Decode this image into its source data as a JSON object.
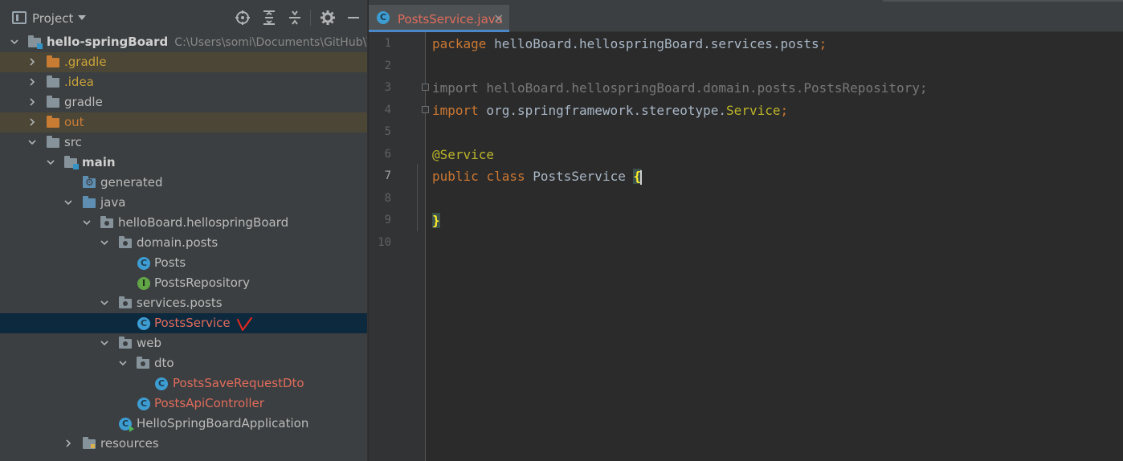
{
  "project_panel": {
    "title": "Project",
    "tree": [
      {
        "label": "hello-springBoard",
        "path": "C:\\Users\\somi\\Documents\\GitHub\\T",
        "icon": "module-folder-icon",
        "expanded": true
      },
      {
        "label": ".gradle",
        "icon": "excluded-folder-icon",
        "expanded": false
      },
      {
        "label": ".idea",
        "icon": "excluded-folder-icon",
        "expanded": false
      },
      {
        "label": "gradle",
        "icon": "folder-icon",
        "expanded": false
      },
      {
        "label": "out",
        "icon": "excluded-folder-icon",
        "expanded": false
      },
      {
        "label": "src",
        "icon": "folder-icon",
        "expanded": true
      },
      {
        "label": "main",
        "icon": "module-folder-icon",
        "expanded": true
      },
      {
        "label": "generated",
        "icon": "generated-folder-icon"
      },
      {
        "label": "java",
        "icon": "source-folder-icon",
        "expanded": true
      },
      {
        "label": "helloBoard.hellospringBoard",
        "icon": "package-icon",
        "expanded": true
      },
      {
        "label": "domain.posts",
        "icon": "package-icon",
        "expanded": true
      },
      {
        "label": "Posts",
        "icon": "class-icon",
        "glyph": "C"
      },
      {
        "label": "PostsRepository",
        "icon": "interface-icon",
        "glyph": "I"
      },
      {
        "label": "services.posts",
        "icon": "package-icon",
        "expanded": true
      },
      {
        "label": "PostsService",
        "icon": "class-icon",
        "glyph": "C",
        "selected": true
      },
      {
        "label": "web",
        "icon": "package-icon",
        "expanded": true
      },
      {
        "label": "dto",
        "icon": "package-icon",
        "expanded": true
      },
      {
        "label": "PostsSaveRequestDto",
        "icon": "class-icon",
        "glyph": "C"
      },
      {
        "label": "PostsApiController",
        "icon": "class-icon",
        "glyph": "C"
      },
      {
        "label": "HelloSpringBoardApplication",
        "icon": "spring-app-class-icon",
        "glyph": "C"
      },
      {
        "label": "resources",
        "icon": "resources-folder-icon",
        "expanded": false
      }
    ]
  },
  "editor": {
    "tab": {
      "label": "PostsService.java",
      "glyph": "C",
      "close": "×"
    },
    "line_numbers": [
      "1",
      "2",
      "3",
      "4",
      "5",
      "6",
      "7",
      "8",
      "9",
      "10"
    ],
    "current_line": "7",
    "code": {
      "l1_kw": "package",
      "l1_rest": " helloBoard.hellospringBoard.services.posts",
      "l1_semi": ";",
      "l3_kw": "import",
      "l3_rest": " helloBoard.hellospringBoard.domain.posts.PostsRepository;",
      "l4_kw": "import",
      "l4_rest": " org.springframework.stereotype.",
      "l4_cls": "Service",
      "l4_semi": ";",
      "l6_ann": "@Service",
      "l7_kw1": "public",
      "l7_kw2": "class",
      "l7_name": " PostsService ",
      "l7_brace": "{",
      "l9_brace": "}"
    }
  },
  "colors": {
    "panel_bg": "#3c3f41",
    "editor_bg": "#2b2b2b",
    "selection": "#0d293e",
    "excluded_row": "#4b4635",
    "keyword": "#cc7832",
    "annotation": "#bbb529",
    "modified_file": "#e06c5c",
    "tab_underline": "#4a88c7"
  }
}
